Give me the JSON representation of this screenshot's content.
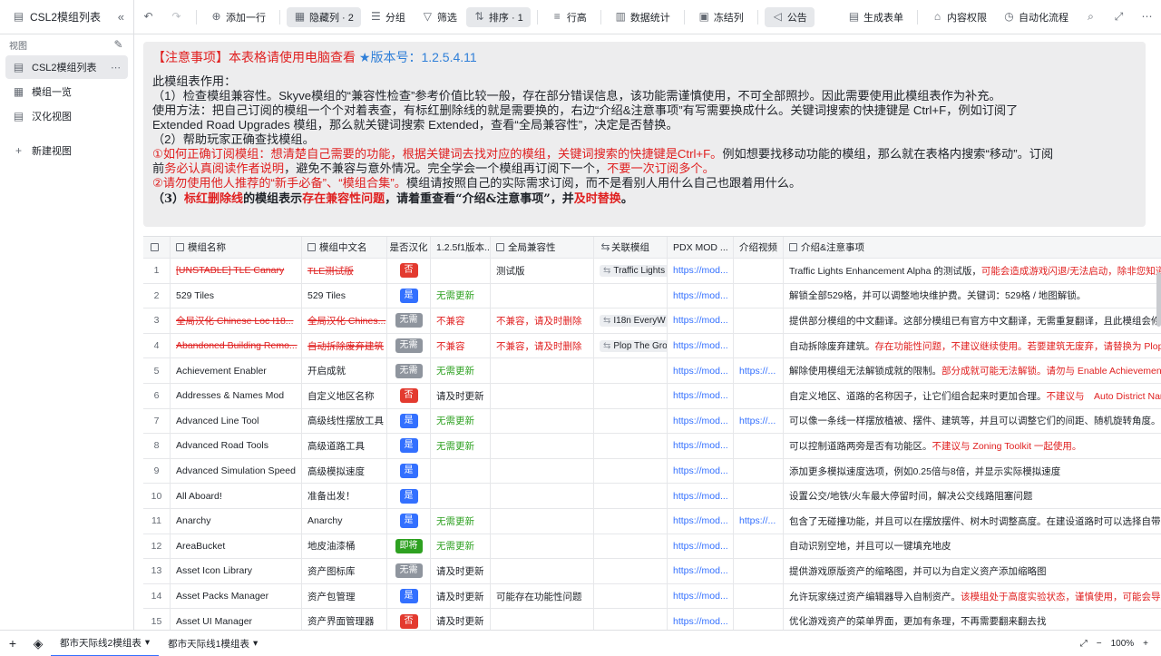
{
  "toolbar": {
    "view_title": "CSL2模组列表",
    "add_row": "添加一行",
    "hidden_cols": "隐藏列 · 2",
    "group": "分组",
    "filter": "筛选",
    "sort": "排序 · 1",
    "row_height": "行高",
    "stats": "数据统计",
    "freeze": "冻结列",
    "announce": "公告",
    "gen_form": "生成表单",
    "permission": "内容权限",
    "automation": "自动化流程"
  },
  "sidebar": {
    "header": "视图",
    "items": [
      {
        "label": "CSL2模组列表"
      },
      {
        "label": "模组一览"
      },
      {
        "label": "汉化视图"
      }
    ],
    "new_view": "新建视图"
  },
  "notes": {
    "title_red": "【注意事项】本表格请使用电脑查看",
    "title_blue": "★版本号：1.2.5.4.11",
    "p1": "此模组表作用：",
    "p2": "（1）检查模组兼容性。Skyve模组的“兼容性检查”参考价值比较一般，存在部分错误信息，该功能需谨慎使用，不可全部照抄。因此需要使用此模组表作为补充。",
    "p3": "使用方法：把自己订阅的模组一个个对着表查，有标红删除线的就是需要换的，右边“介绍&注意事项”有写需要换成什么。关键词搜索的快捷键是 Ctrl+F，例如订阅了",
    "p4": "Extended Road Upgrades 模组，那么就关键词搜索 Extended，查看“全局兼容性”，决定是否替换。",
    "p5": "（2）帮助玩家正确查找模组。",
    "p6_red": "①如何正确订阅模组：想清楚自己需要的功能，根据关键词去找对应的模组，关键词搜索的快捷键是Ctrl+F。",
    "p6_rest": "例如想要找移动功能的模组，那么就在表格内搜索“移动”。订阅",
    "p7_a": "前",
    "p7_red": "务必认真阅读作者说明",
    "p7_b": "，避免不兼容与意外情况。完全学会一个模组再订阅下一个，",
    "p7_red2": "不要一次订阅多个。",
    "p8_red": "②请勿使用他人推荐的“新手必备”、“模组合集”。",
    "p8_rest": "模组请按照自己的实际需求订阅，而不是看别人用什么自己也跟着用什么。",
    "p9_a": "（3）",
    "p9_b": "标红删除线",
    "p9_c": "的模组表示",
    "p9_d": "存在兼容性问题",
    "p9_e": "，请着重查看“介绍&注意事项”，并",
    "p9_f": "及时替换",
    "p9_g": "。"
  },
  "table": {
    "headers": [
      "模组名称",
      "模组中文名",
      "是否汉化",
      "1.2.5f1版本...",
      "全局兼容性",
      "关联模组",
      "PDX MOD ...",
      "介绍视频",
      "介绍&注意事项"
    ],
    "rows": [
      {
        "n": "1",
        "name": "[UNSTABLE] TLE Canary",
        "cn": "TLE测试版",
        "loc": "否",
        "ver": "",
        "compat": "测试版",
        "rel": "Traffic Lights",
        "pdx": "https://mod...",
        "vid": "",
        "note": "Traffic Lights Enhancement Alpha 的测试版，",
        "note_red": "可能会造成游戏闪退/无法启动，除非您知道自",
        "strike": true
      },
      {
        "n": "2",
        "name": "529 Tiles",
        "cn": "529 Tiles",
        "loc": "是",
        "ver": "无需更新",
        "compat": "",
        "rel": "",
        "pdx": "https://mod...",
        "vid": "",
        "note": "解锁全部529格，并可以调整地块维护费。关键词：529格 / 地图解锁。",
        "note_red": "",
        "strike": false
      },
      {
        "n": "3",
        "name": "全局汉化 Chinese Loc I18...",
        "cn": "全局汉化 Chines...",
        "loc": "无需",
        "ver": "不兼容",
        "compat": "不兼容，请及时删除",
        "rel": "I18n EveryW",
        "pdx": "https://mod...",
        "vid": "",
        "note": "提供部分模组的中文翻译。这部分模组已有官方中文翻译，无需重复翻译，且此模组会修改",
        "note_red": "",
        "strike": true
      },
      {
        "n": "4",
        "name": "Abandoned Building Remo...",
        "cn": "自动拆除废弃建筑",
        "loc": "无需",
        "ver": "不兼容",
        "compat": "不兼容，请及时删除",
        "rel": "Plop The Gro",
        "pdx": "https://mod...",
        "vid": "",
        "note": "自动拆除废弃建筑。",
        "note_red": "存在功能性问题，不建议继续使用。若要建筑无废弃，请替换为 Plop Th",
        "strike": true
      },
      {
        "n": "5",
        "name": "Achievement Enabler",
        "cn": "开启成就",
        "loc": "无需",
        "ver": "无需更新",
        "compat": "",
        "rel": "",
        "pdx": "https://mod...",
        "vid": "https://...",
        "note": "解除使用模组无法解锁成就的限制。",
        "note_red": "部分成就可能无法解锁。请勿与 Enable Achievements 一",
        "strike": false
      },
      {
        "n": "6",
        "name": "Addresses & Names Mod",
        "cn": "自定义地区名称",
        "loc": "否",
        "ver": "请及时更新",
        "compat": "",
        "rel": "",
        "pdx": "https://mod...",
        "vid": "",
        "note": "自定义地区、道路的名称因子，让它们组合起来时更加合理。",
        "note_red": "不建议与　Auto District Name",
        "strike": false
      },
      {
        "n": "7",
        "name": "Advanced Line Tool",
        "cn": "高级线性摆放工具",
        "loc": "是",
        "ver": "无需更新",
        "compat": "",
        "rel": "",
        "pdx": "https://mod...",
        "vid": "https://...",
        "note": "可以像一条线一样摆放植被、摆件、建筑等，并且可以调整它们的间距、随机旋转角度。关",
        "note_red": "",
        "strike": false
      },
      {
        "n": "8",
        "name": "Advanced Road Tools",
        "cn": "高级道路工具",
        "loc": "是",
        "ver": "无需更新",
        "compat": "",
        "rel": "",
        "pdx": "https://mod...",
        "vid": "",
        "note": "可以控制道路两旁是否有功能区。",
        "note_red": "不建议与 Zoning Toolkit 一起使用。",
        "strike": false
      },
      {
        "n": "9",
        "name": "Advanced Simulation Speed",
        "cn": "高级模拟速度",
        "loc": "是",
        "ver": "",
        "compat": "",
        "rel": "",
        "pdx": "https://mod...",
        "vid": "",
        "note": "添加更多模拟速度选项，例如0.25倍与8倍，并显示实际模拟速度",
        "note_red": "",
        "strike": false
      },
      {
        "n": "10",
        "name": "All Aboard!",
        "cn": "准备出发！",
        "loc": "是",
        "ver": "",
        "compat": "",
        "rel": "",
        "pdx": "https://mod...",
        "vid": "",
        "note": "设置公交/地铁/火车最大停留时间，解决公交线路阻塞问题",
        "note_red": "",
        "strike": false
      },
      {
        "n": "11",
        "name": "Anarchy",
        "cn": "Anarchy",
        "loc": "是",
        "ver": "无需更新",
        "compat": "",
        "rel": "",
        "pdx": "https://mod...",
        "vid": "https://...",
        "note": "包含了无碰撞功能，并且可以在摆放摆件、树木时调整高度。在建设道路时可以选择自带护",
        "note_red": "",
        "strike": false
      },
      {
        "n": "12",
        "name": "AreaBucket",
        "cn": "地皮油漆桶",
        "loc": "即将",
        "ver": "无需更新",
        "compat": "",
        "rel": "",
        "pdx": "https://mod...",
        "vid": "",
        "note": "自动识别空地，并且可以一键填充地皮",
        "note_red": "",
        "strike": false
      },
      {
        "n": "13",
        "name": "Asset Icon Library",
        "cn": "资产图标库",
        "loc": "无需",
        "ver": "请及时更新",
        "compat": "",
        "rel": "",
        "pdx": "https://mod...",
        "vid": "",
        "note": "提供游戏原版资产的缩略图，并可以为自定义资产添加缩略图",
        "note_red": "",
        "strike": false
      },
      {
        "n": "14",
        "name": "Asset Packs Manager",
        "cn": "资产包管理",
        "loc": "是",
        "ver": "请及时更新",
        "compat": "可能存在功能性问题",
        "rel": "",
        "pdx": "https://mod...",
        "vid": "",
        "note": "允许玩家绕过资产编辑器导入自制资产。",
        "note_red": "该模组处于高度实验状态，谨慎使用，可能会导致",
        "strike": false
      },
      {
        "n": "15",
        "name": "Asset UI Manager",
        "cn": "资产界面管理器",
        "loc": "否",
        "ver": "请及时更新",
        "compat": "",
        "rel": "",
        "pdx": "https://mod...",
        "vid": "",
        "note": "优化游戏资产的菜单界面，更加有条理，不再需要翻来翻去找",
        "note_red": "",
        "strike": false
      }
    ]
  },
  "bottom": {
    "sheet1": "都市天际线2模组表",
    "sheet2": "都市天际线1模组表",
    "zoom": "100%"
  },
  "colors": {
    "accent": "#3370ff",
    "red": "#e02020",
    "green": "#2ea121"
  }
}
